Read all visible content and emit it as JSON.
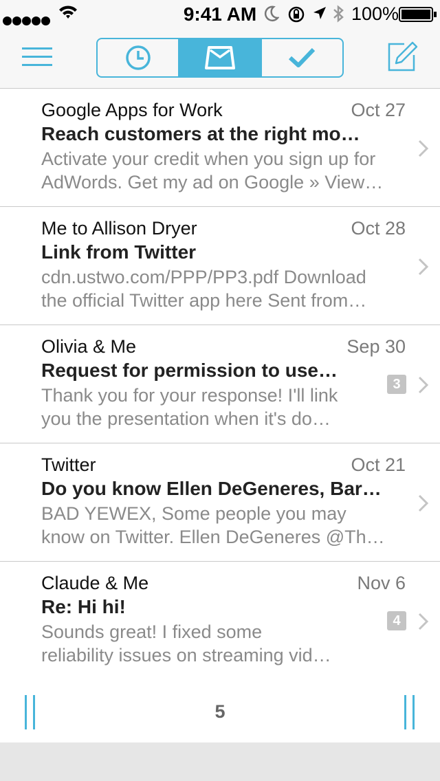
{
  "status_bar": {
    "time": "9:41 AM",
    "battery_percent": "100%",
    "signal_bars": 5,
    "icons": [
      "signal-dots-icon",
      "wifi-icon",
      "moon-icon",
      "orientation-lock-icon",
      "location-arrow-icon",
      "bluetooth-icon",
      "battery-icon"
    ]
  },
  "navbar": {
    "icons": [
      "menu-icon",
      "clock-icon",
      "inbox-tray-icon",
      "checkmark-icon",
      "compose-icon"
    ],
    "active_segment": "inbox"
  },
  "colors": {
    "accent": "#48b5da",
    "badge": "#c4c4c4"
  },
  "messages": [
    {
      "sender": "Google Apps for Work",
      "date": "Oct 27",
      "subject": "Reach customers at the right mo…",
      "preview_line1": "Activate your credit when you sign up for",
      "preview_line2": "AdWords. Get my ad on Google » View…",
      "count": ""
    },
    {
      "sender": "Me to Allison Dryer",
      "date": "Oct 28",
      "subject": "Link from Twitter",
      "preview_line1": "cdn.ustwo.com/PPP/PP3.pdf Download",
      "preview_line2": "the official Twitter app here Sent from…",
      "count": ""
    },
    {
      "sender": "Olivia & Me",
      "date": "Sep 30",
      "subject": "Request for permission to use…",
      "preview_line1": "Thank you for your response! I'll link",
      "preview_line2": "you the presentation when it's do…",
      "count": "3"
    },
    {
      "sender": "Twitter",
      "date": "Oct 21",
      "subject": "Do you know Ellen DeGeneres, Bar…",
      "preview_line1": "BAD YEWEX, Some people you may",
      "preview_line2": "know on Twitter. Ellen DeGeneres @Th…",
      "count": ""
    },
    {
      "sender": "Claude & Me",
      "date": "Nov 6",
      "subject": "Re: Hi hi!",
      "preview_line1": "Sounds great! I fixed some",
      "preview_line2": "reliability issues on streaming vid…",
      "count": "4"
    }
  ],
  "bottom_bar": {
    "message_count": "5"
  }
}
